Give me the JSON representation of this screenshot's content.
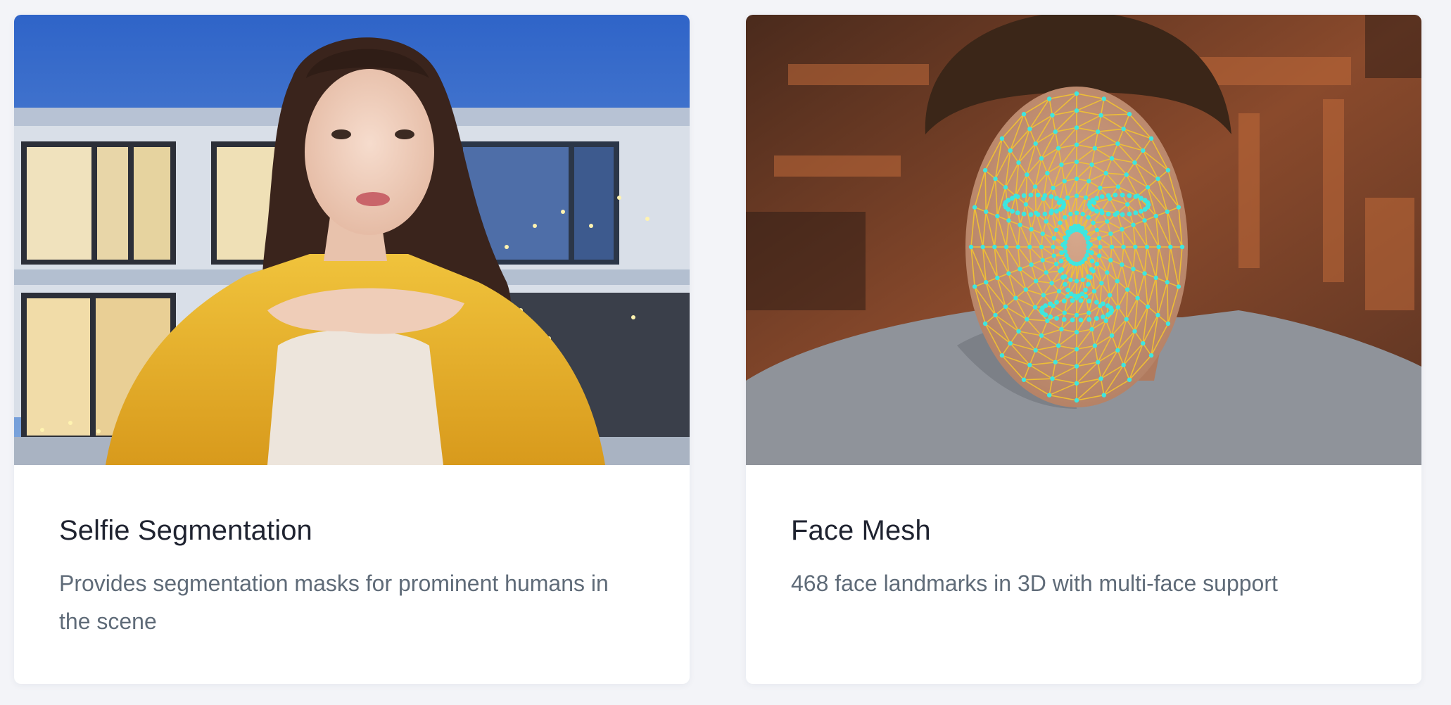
{
  "cards": [
    {
      "title": "Selfie Segmentation",
      "description": "Provides segmentation masks for prominent humans in the scene",
      "image_icon": "selfie-segmentation-photo-icon"
    },
    {
      "title": "Face Mesh",
      "description": "468 face landmarks in 3D with multi-face support",
      "image_icon": "face-mesh-photo-icon"
    }
  ],
  "colors": {
    "page_background": "#f3f4f8",
    "card_background": "#ffffff",
    "title": "#1f2330",
    "description": "#5f6b78",
    "mesh_lines": "#f3c431",
    "mesh_points": "#3ee6e0"
  }
}
